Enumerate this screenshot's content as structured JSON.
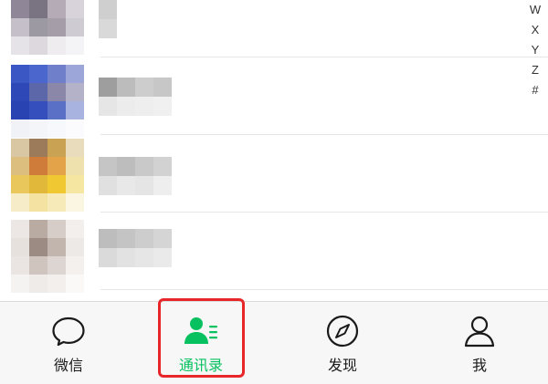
{
  "index_letters": [
    "W",
    "X",
    "Y",
    "Z",
    "#"
  ],
  "tabs": [
    {
      "label": "微信",
      "icon": "chat-bubble-icon",
      "active": false
    },
    {
      "label": "通讯录",
      "icon": "contacts-icon",
      "active": true
    },
    {
      "label": "发现",
      "icon": "compass-icon",
      "active": false
    },
    {
      "label": "我",
      "icon": "person-icon",
      "active": false
    }
  ],
  "colors": {
    "active": "#07c160",
    "inactive": "#1a1a1a",
    "highlight": "#e8262a",
    "tabbar_bg": "#f7f7f7"
  }
}
